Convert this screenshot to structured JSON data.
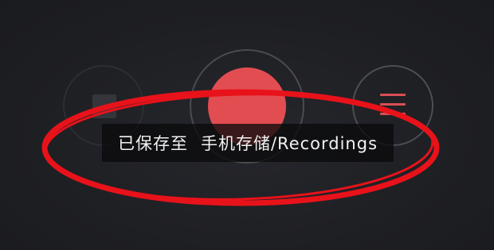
{
  "controls": {
    "stop_icon": "stop-square-icon",
    "record_icon": "record-dot-icon",
    "list_icon": "menu-list-icon"
  },
  "toast": {
    "prefix": "已保存至",
    "path": "手机存储/Recordings"
  },
  "colors": {
    "background": "#1d1e22",
    "record_red": "#e24d51",
    "annotation_red": "#e8121a",
    "toast_bg": "#0a0a0c",
    "toast_text": "#f2f2f2"
  }
}
